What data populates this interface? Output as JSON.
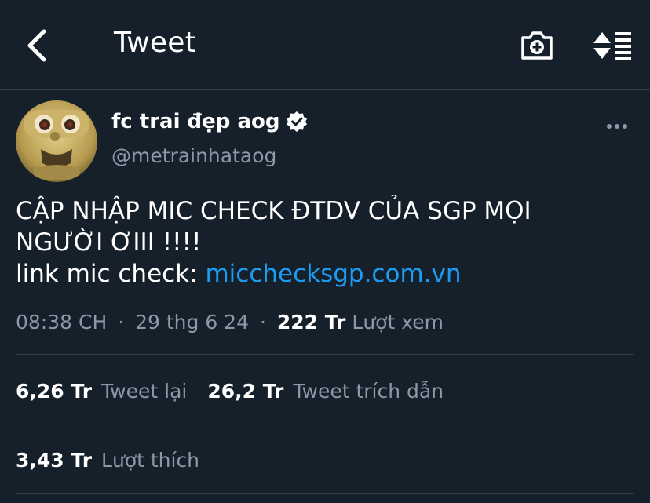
{
  "header": {
    "title": "Tweet",
    "back_icon": "chevron-left-icon",
    "camera_icon": "camera-plus-icon",
    "sort_icon": "sort-list-icon"
  },
  "tweet": {
    "author": {
      "display_name": "fc trai đẹp aog",
      "handle": "@metrainhataog",
      "verified": true
    },
    "text_lines": [
      "CẬP NHẬP MIC CHECK ĐTDV CỦA SGP MỌI",
      "NGƯỜI ƠIII !!!!"
    ],
    "link_prefix": "link mic check: ",
    "link_text": "micchecksgp.com.vn",
    "time": "08:38 CH",
    "date": "29 thg 6 24",
    "separator": "·",
    "views_count": "222 Tr",
    "views_label": "Lượt xem"
  },
  "stats": {
    "retweets_count": "6,26 Tr",
    "retweets_label": "Tweet lại",
    "quotes_count": "26,2 Tr",
    "quotes_label": "Tweet trích dẫn",
    "likes_count": "3,43 Tr",
    "likes_label": "Lượt thích"
  },
  "colors": {
    "background": "#15202b",
    "text": "#ffffff",
    "secondary_text": "#8b98a5",
    "link": "#1d9bf0",
    "divider": "#2f3b47"
  }
}
